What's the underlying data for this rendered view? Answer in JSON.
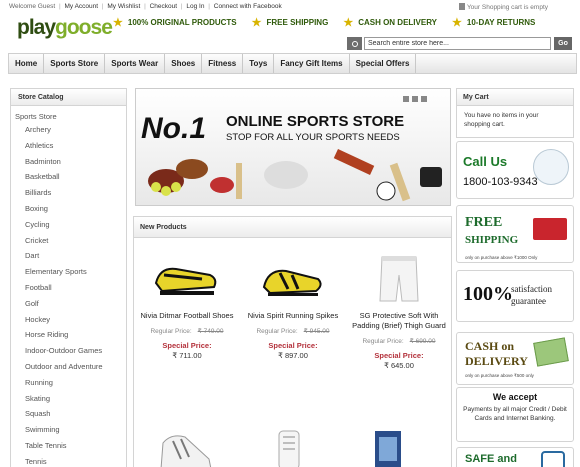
{
  "toplinks": {
    "welcome": "Welcome Guest",
    "my_account": "My Account",
    "my_wishlist": "My Wishlist",
    "checkout": "Checkout",
    "login": "Log In",
    "connect_facebook": "Connect with Facebook",
    "cart_message": "Your Shopping cart is empty"
  },
  "logo": {
    "part1": "play",
    "part2": "goose"
  },
  "promos": [
    "100% ORIGINAL PRODUCTS",
    "FREE SHIPPING",
    "CASH ON DELIVERY",
    "10-DAY RETURNS"
  ],
  "search": {
    "placeholder": "Search entire store here...",
    "value": "Search entire store here...",
    "go_label": "Go"
  },
  "nav": [
    "Home",
    "Sports Store",
    "Sports Wear",
    "Shoes",
    "Fitness",
    "Toys",
    "Fancy Gift Items",
    "Special Offers"
  ],
  "sidebar": {
    "title": "Store Catalog",
    "root": "Sports Store",
    "items": [
      "Archery",
      "Athletics",
      "Badminton",
      "Basketball",
      "Billiards",
      "Boxing",
      "Cycling",
      "Cricket",
      "Dart",
      "Elementary Sports",
      "Football",
      "Golf",
      "Hockey",
      "Horse Riding",
      "Indoor-Outdoor Games",
      "Outdoor and Adventure",
      "Running",
      "Skating",
      "Squash",
      "Swimming",
      "Table Tennis",
      "Tennis"
    ]
  },
  "banner": {
    "headline_no": "No.1",
    "headline": "ONLINE SPORTS STORE",
    "tagline": "STOP FOR ALL YOUR SPORTS NEEDS"
  },
  "new_products": {
    "title": "New Products",
    "regular_label": "Regular Price:",
    "special_label": "Special Price:",
    "items": [
      {
        "name": "Nivia Ditmar Football Shoes",
        "regular": "₹ 749.00",
        "special": "₹ 711.00"
      },
      {
        "name": "Nivia Spirit Running Spikes",
        "regular": "₹ 945.00",
        "special": "₹ 897.00"
      },
      {
        "name": "SG Protective Soft With Padding (Brief) Thigh Guard",
        "regular": "₹ 699.00",
        "special": "₹ 645.00"
      }
    ]
  },
  "cart": {
    "title": "My Cart",
    "message": "You have no items in your shopping cart."
  },
  "callus": {
    "label": "Call Us",
    "number": "1800-103-9343"
  },
  "free_shipping": {
    "line1": "FREE",
    "line2": "SHIPPING",
    "note": "only on purchase above ₹1000 Only"
  },
  "guarantee": {
    "big": "100%",
    "line1": "satisfaction",
    "line2": "guarantee"
  },
  "cod": {
    "line1": "CASH on",
    "line2": "DELIVERY",
    "note": "only on purchase above ₹500 only"
  },
  "accept": {
    "title": "We accept",
    "desc": "Payments by all major Credit / Debit Cards and Internet Banking."
  },
  "safe": {
    "label": "SAFE and"
  },
  "colors": {
    "brand_green": "#1d6b2c",
    "promo_green": "#2f5a0a",
    "special_red": "#b4323c",
    "star_gold": "#d8b400"
  }
}
